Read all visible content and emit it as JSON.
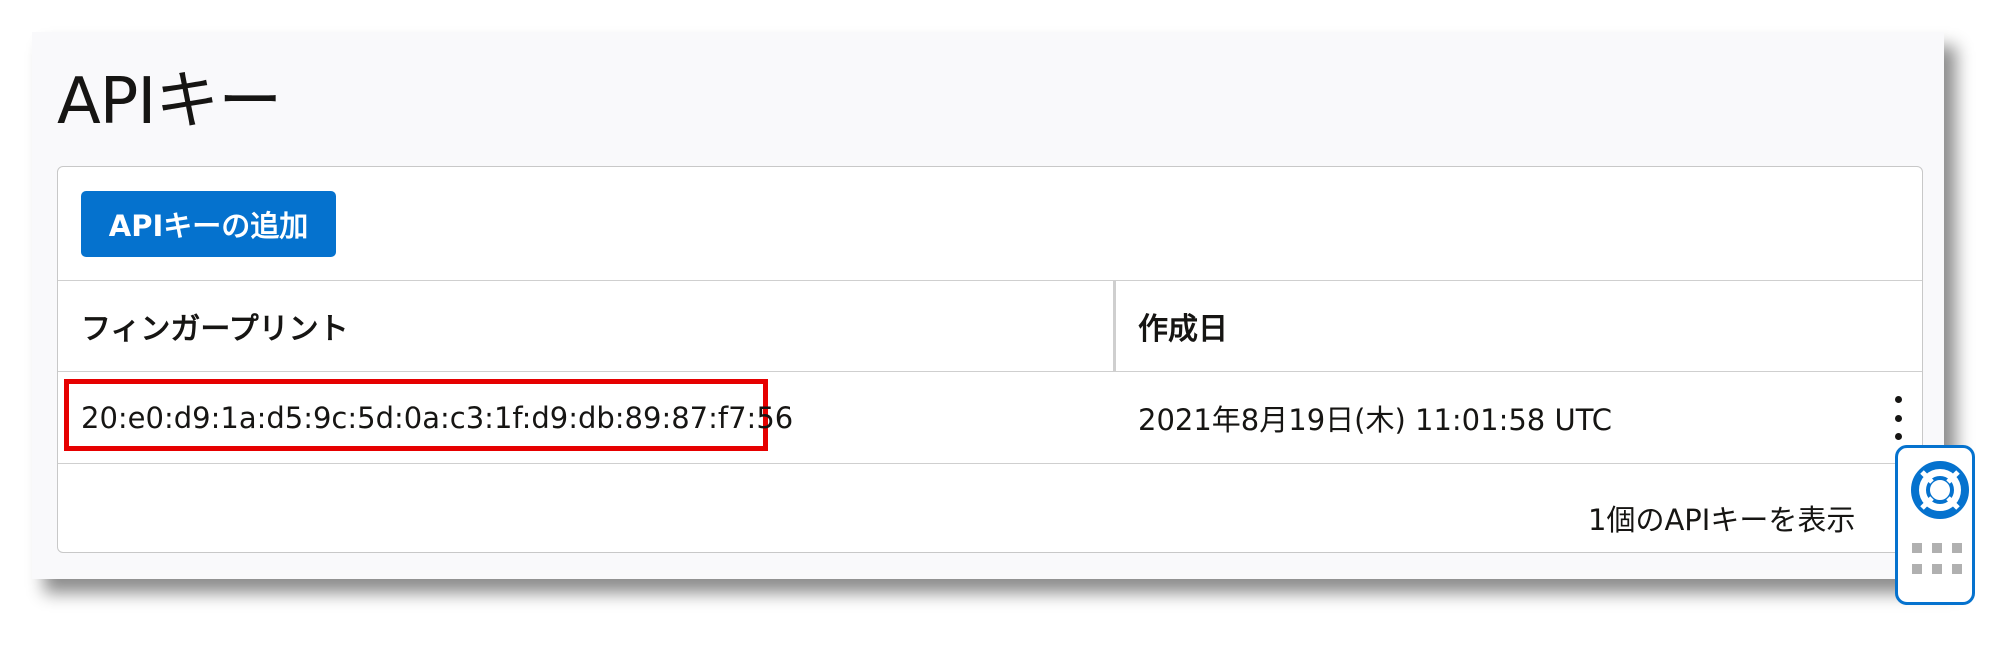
{
  "page": {
    "title": "APIキー"
  },
  "toolbar": {
    "add_button_label": "APIキーの追加"
  },
  "table": {
    "columns": [
      "フィンガープリント",
      "作成日"
    ],
    "rows": [
      {
        "fingerprint": "20:e0:d9:1a:d5:9c:5d:0a:c3:1f:d9:db:89:87:f7:56",
        "created": "2021年8月19日(木) 11:01:58 UTC",
        "actions_icon": "kebab-menu-icon"
      }
    ],
    "footer_text": "1個のAPIキーを表示"
  },
  "help_widget": {
    "icon": "lifebuoy-icon",
    "handle_icon": "grip-icon"
  },
  "colors": {
    "accent": "#0572ce",
    "highlight": "#e60000",
    "panel_bg": "#f9f9fb",
    "text": "#161513"
  }
}
